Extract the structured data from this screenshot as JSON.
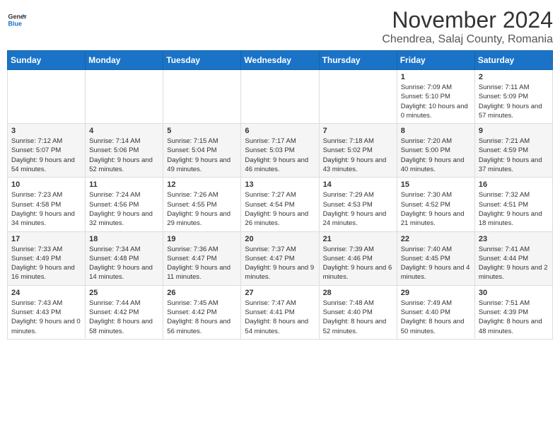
{
  "header": {
    "logo_line1": "General",
    "logo_line2": "Blue",
    "month_title": "November 2024",
    "location": "Chendrea, Salaj County, Romania"
  },
  "days_of_week": [
    "Sunday",
    "Monday",
    "Tuesday",
    "Wednesday",
    "Thursday",
    "Friday",
    "Saturday"
  ],
  "weeks": [
    [
      {
        "day": "",
        "info": ""
      },
      {
        "day": "",
        "info": ""
      },
      {
        "day": "",
        "info": ""
      },
      {
        "day": "",
        "info": ""
      },
      {
        "day": "",
        "info": ""
      },
      {
        "day": "1",
        "info": "Sunrise: 7:09 AM\nSunset: 5:10 PM\nDaylight: 10 hours and 0 minutes."
      },
      {
        "day": "2",
        "info": "Sunrise: 7:11 AM\nSunset: 5:09 PM\nDaylight: 9 hours and 57 minutes."
      }
    ],
    [
      {
        "day": "3",
        "info": "Sunrise: 7:12 AM\nSunset: 5:07 PM\nDaylight: 9 hours and 54 minutes."
      },
      {
        "day": "4",
        "info": "Sunrise: 7:14 AM\nSunset: 5:06 PM\nDaylight: 9 hours and 52 minutes."
      },
      {
        "day": "5",
        "info": "Sunrise: 7:15 AM\nSunset: 5:04 PM\nDaylight: 9 hours and 49 minutes."
      },
      {
        "day": "6",
        "info": "Sunrise: 7:17 AM\nSunset: 5:03 PM\nDaylight: 9 hours and 46 minutes."
      },
      {
        "day": "7",
        "info": "Sunrise: 7:18 AM\nSunset: 5:02 PM\nDaylight: 9 hours and 43 minutes."
      },
      {
        "day": "8",
        "info": "Sunrise: 7:20 AM\nSunset: 5:00 PM\nDaylight: 9 hours and 40 minutes."
      },
      {
        "day": "9",
        "info": "Sunrise: 7:21 AM\nSunset: 4:59 PM\nDaylight: 9 hours and 37 minutes."
      }
    ],
    [
      {
        "day": "10",
        "info": "Sunrise: 7:23 AM\nSunset: 4:58 PM\nDaylight: 9 hours and 34 minutes."
      },
      {
        "day": "11",
        "info": "Sunrise: 7:24 AM\nSunset: 4:56 PM\nDaylight: 9 hours and 32 minutes."
      },
      {
        "day": "12",
        "info": "Sunrise: 7:26 AM\nSunset: 4:55 PM\nDaylight: 9 hours and 29 minutes."
      },
      {
        "day": "13",
        "info": "Sunrise: 7:27 AM\nSunset: 4:54 PM\nDaylight: 9 hours and 26 minutes."
      },
      {
        "day": "14",
        "info": "Sunrise: 7:29 AM\nSunset: 4:53 PM\nDaylight: 9 hours and 24 minutes."
      },
      {
        "day": "15",
        "info": "Sunrise: 7:30 AM\nSunset: 4:52 PM\nDaylight: 9 hours and 21 minutes."
      },
      {
        "day": "16",
        "info": "Sunrise: 7:32 AM\nSunset: 4:51 PM\nDaylight: 9 hours and 18 minutes."
      }
    ],
    [
      {
        "day": "17",
        "info": "Sunrise: 7:33 AM\nSunset: 4:49 PM\nDaylight: 9 hours and 16 minutes."
      },
      {
        "day": "18",
        "info": "Sunrise: 7:34 AM\nSunset: 4:48 PM\nDaylight: 9 hours and 14 minutes."
      },
      {
        "day": "19",
        "info": "Sunrise: 7:36 AM\nSunset: 4:47 PM\nDaylight: 9 hours and 11 minutes."
      },
      {
        "day": "20",
        "info": "Sunrise: 7:37 AM\nSunset: 4:47 PM\nDaylight: 9 hours and 9 minutes."
      },
      {
        "day": "21",
        "info": "Sunrise: 7:39 AM\nSunset: 4:46 PM\nDaylight: 9 hours and 6 minutes."
      },
      {
        "day": "22",
        "info": "Sunrise: 7:40 AM\nSunset: 4:45 PM\nDaylight: 9 hours and 4 minutes."
      },
      {
        "day": "23",
        "info": "Sunrise: 7:41 AM\nSunset: 4:44 PM\nDaylight: 9 hours and 2 minutes."
      }
    ],
    [
      {
        "day": "24",
        "info": "Sunrise: 7:43 AM\nSunset: 4:43 PM\nDaylight: 9 hours and 0 minutes."
      },
      {
        "day": "25",
        "info": "Sunrise: 7:44 AM\nSunset: 4:42 PM\nDaylight: 8 hours and 58 minutes."
      },
      {
        "day": "26",
        "info": "Sunrise: 7:45 AM\nSunset: 4:42 PM\nDaylight: 8 hours and 56 minutes."
      },
      {
        "day": "27",
        "info": "Sunrise: 7:47 AM\nSunset: 4:41 PM\nDaylight: 8 hours and 54 minutes."
      },
      {
        "day": "28",
        "info": "Sunrise: 7:48 AM\nSunset: 4:40 PM\nDaylight: 8 hours and 52 minutes."
      },
      {
        "day": "29",
        "info": "Sunrise: 7:49 AM\nSunset: 4:40 PM\nDaylight: 8 hours and 50 minutes."
      },
      {
        "day": "30",
        "info": "Sunrise: 7:51 AM\nSunset: 4:39 PM\nDaylight: 8 hours and 48 minutes."
      }
    ]
  ]
}
